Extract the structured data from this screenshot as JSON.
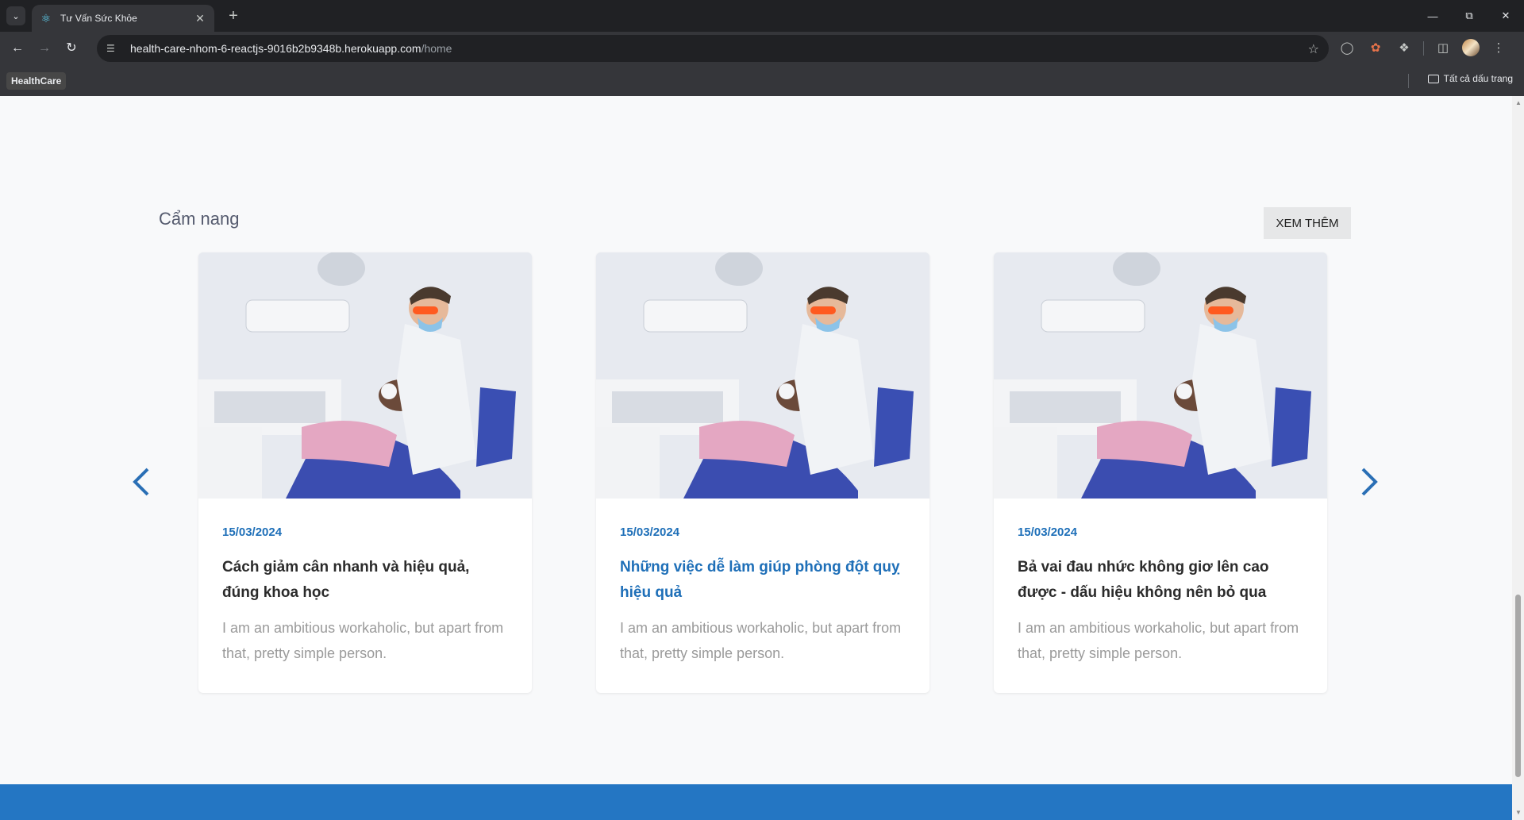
{
  "browser": {
    "tab_title": "Tư Vấn Sức Khỏe",
    "url_host": "health-care-nhom-6-reactjs-9016b2b9348b.herokuapp.com",
    "url_path": "/home",
    "bookmark": "HealthCare",
    "all_bookmarks": "Tất cả dấu trang"
  },
  "section": {
    "title": "Cẩm nang",
    "more_label": "XEM THÊM"
  },
  "cards": [
    {
      "date": "15/03/2024",
      "title": "Cách giảm cân nhanh và hiệu quả, đúng khoa học",
      "desc": "I am an ambitious workaholic, but apart from that, pretty simple person."
    },
    {
      "date": "15/03/2024",
      "title": "Những việc dễ làm giúp phòng đột quỵ hiệu quả",
      "desc": "I am an ambitious workaholic, but apart from that, pretty simple person."
    },
    {
      "date": "15/03/2024",
      "title": "Bả vai đau nhức không giơ lên cao được - dấu hiệu không nên bỏ qua",
      "desc": "I am an ambitious workaholic, but apart from that, pretty simple person."
    }
  ],
  "colors": {
    "accent": "#1e6fb8",
    "footer": "#2476c3"
  },
  "icons": {
    "prev": "chevron-left-icon",
    "next": "chevron-right-icon"
  }
}
